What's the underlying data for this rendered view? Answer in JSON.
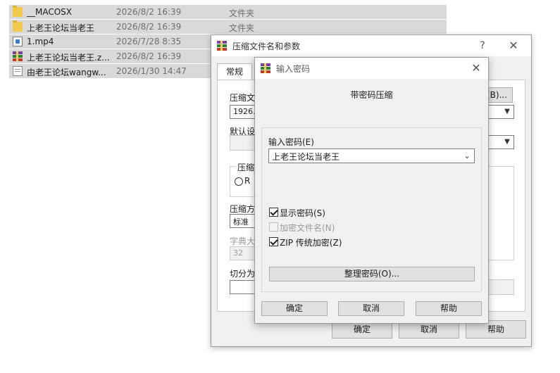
{
  "files": [
    {
      "name": "__MACOSX",
      "date": "2026/8/2 16:39",
      "type": "文件夹",
      "icon": "folder-icon"
    },
    {
      "name": "上老王论坛当老王",
      "date": "2026/8/2 16:39",
      "type": "文件夹",
      "icon": "folder-icon"
    },
    {
      "name": "1.mp4",
      "date": "2026/7/28 8:35",
      "type": "",
      "icon": "video-file-icon"
    },
    {
      "name": "上老王论坛当老王.z...",
      "date": "2026/8/2 16:39",
      "type": "",
      "icon": "winrar-archive-icon"
    },
    {
      "name": "由老王论坛wangw...",
      "date": "2026/1/30 14:47",
      "type": "",
      "icon": "text-document-icon"
    }
  ],
  "main_dialog": {
    "title": "压缩文件名和参数",
    "help_glyph": "?",
    "close_glyph": "✕",
    "tab_general": "常规",
    "archive_name_label": "压缩文",
    "archive_name_value": "1926.z",
    "browse_label": "(B)...",
    "default_profile_label": "默认设",
    "format_group_label": "压缩",
    "format_radio_label": "R",
    "method_label": "压缩方",
    "method_value": "标准",
    "dict_label": "字典大",
    "dict_value": "32",
    "split_label": "切分为",
    "ok": "确定",
    "cancel": "取消",
    "help": "帮助"
  },
  "password_dialog": {
    "title": "输入密码",
    "close_glyph": "✕",
    "heading": "带密码压缩",
    "password_label": "输入密码(E)",
    "password_value": "上老王论坛当老王",
    "show_password": {
      "label": "显示密码(S)",
      "checked": true
    },
    "encrypt_names": {
      "label": "加密文件名(N)",
      "checked": false,
      "disabled": true
    },
    "zip_legacy": {
      "label": "ZIP 传统加密(Z)",
      "checked": true
    },
    "organize_button": "整理密码(O)...",
    "ok": "确定",
    "cancel": "取消",
    "help": "帮助"
  },
  "colors": {
    "selection_gray": "#d9d9d9",
    "dialog_bg": "#f0f0f0",
    "folder_yellow": "#f2c94c"
  }
}
